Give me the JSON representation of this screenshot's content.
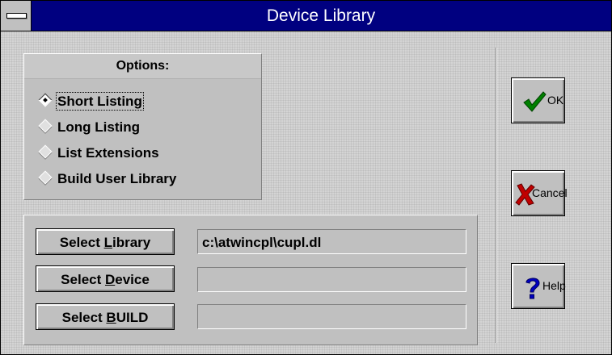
{
  "window": {
    "title": "Device Library"
  },
  "options": {
    "header": "Options:",
    "items": [
      {
        "label": "Short Listing",
        "checked": true
      },
      {
        "label": "Long Listing",
        "checked": false
      },
      {
        "label": "List Extensions",
        "checked": false
      },
      {
        "label": "Build User Library",
        "checked": false
      }
    ]
  },
  "select": {
    "library": {
      "pre": "Select ",
      "key": "L",
      "post": "ibrary",
      "value": "c:\\atwincpl\\cupl.dl"
    },
    "device": {
      "pre": "Select ",
      "key": "D",
      "post": "evice",
      "value": ""
    },
    "build": {
      "pre": "Select ",
      "key": "B",
      "post": "UILD",
      "value": ""
    }
  },
  "buttons": {
    "ok": {
      "label": "OK",
      "icon": "checkmark-icon",
      "color": "#008000"
    },
    "cancel": {
      "label": "Cancel",
      "icon": "x-icon",
      "color": "#c00000"
    },
    "help": {
      "label": "Help",
      "icon": "question-icon",
      "color": "#0000c0"
    }
  }
}
